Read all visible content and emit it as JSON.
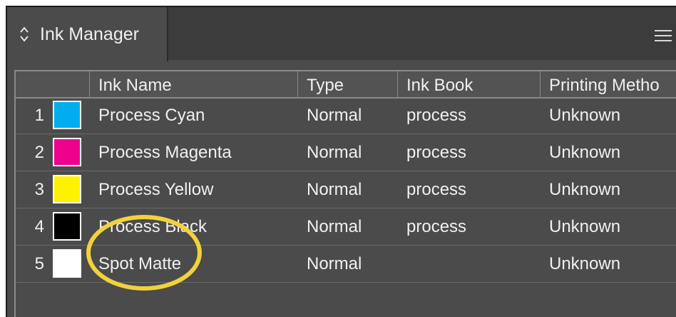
{
  "panel": {
    "tab_title": "Ink Manager",
    "chevron_icon": "up-down-chevron-icon",
    "menu_icon": "hamburger-menu-icon"
  },
  "table": {
    "headers": [
      "Ink Name",
      "Type",
      "Ink Book",
      "Printing Metho"
    ],
    "rows": [
      {
        "num": "1",
        "swatch": "#00aeef",
        "name": "Process Cyan",
        "type": "Normal",
        "book": "process",
        "method": "Unknown"
      },
      {
        "num": "2",
        "swatch": "#ec008c",
        "name": "Process Magenta",
        "type": "Normal",
        "book": "process",
        "method": "Unknown"
      },
      {
        "num": "3",
        "swatch": "#fff200",
        "name": "Process Yellow",
        "type": "Normal",
        "book": "process",
        "method": "Unknown"
      },
      {
        "num": "4",
        "swatch": "#000000",
        "name": "Process Black",
        "type": "Normal",
        "book": "process",
        "method": "Unknown"
      },
      {
        "num": "5",
        "swatch": "#ffffff",
        "name": "Spot Matte",
        "type": "Normal",
        "book": "",
        "method": "Unknown"
      }
    ]
  },
  "annotation": {
    "color": "#f2d23c",
    "target": "Spot Matte"
  }
}
